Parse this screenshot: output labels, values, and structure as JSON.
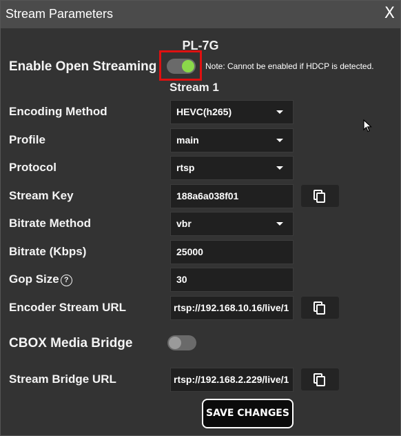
{
  "dialog": {
    "title": "Stream Parameters",
    "close_label": "X",
    "device_name": "PL-7G",
    "stream_title": "Stream 1"
  },
  "open_streaming": {
    "label": "Enable Open Streaming",
    "enabled": true,
    "note": "Note: Cannot be enabled if HDCP is detected."
  },
  "fields": {
    "encoding_method": {
      "label": "Encoding Method",
      "value": "HEVC(h265)"
    },
    "profile": {
      "label": "Profile",
      "value": "main"
    },
    "protocol": {
      "label": "Protocol",
      "value": "rtsp"
    },
    "stream_key": {
      "label": "Stream Key",
      "value": "188a6a038f01"
    },
    "bitrate_method": {
      "label": "Bitrate Method",
      "value": "vbr"
    },
    "bitrate": {
      "label": "Bitrate (Kbps)",
      "value": "25000"
    },
    "gop_size": {
      "label": "Gop Size",
      "value": "30",
      "help": "?"
    },
    "encoder_stream_url": {
      "label": "Encoder Stream URL",
      "value": "rtsp://192.168.10.16/live/1"
    }
  },
  "cbox": {
    "label": "CBOX Media Bridge",
    "enabled": false
  },
  "bridge": {
    "label": "Stream Bridge URL",
    "value": "rtsp://192.168.2.229/live/1"
  },
  "actions": {
    "save_label": "SAVE CHANGES"
  },
  "colors": {
    "toggle_on": "#8bd94a",
    "highlight_border": "#e01010",
    "dialog_bg": "#333333",
    "titlebar_bg": "#4b4b4b"
  }
}
